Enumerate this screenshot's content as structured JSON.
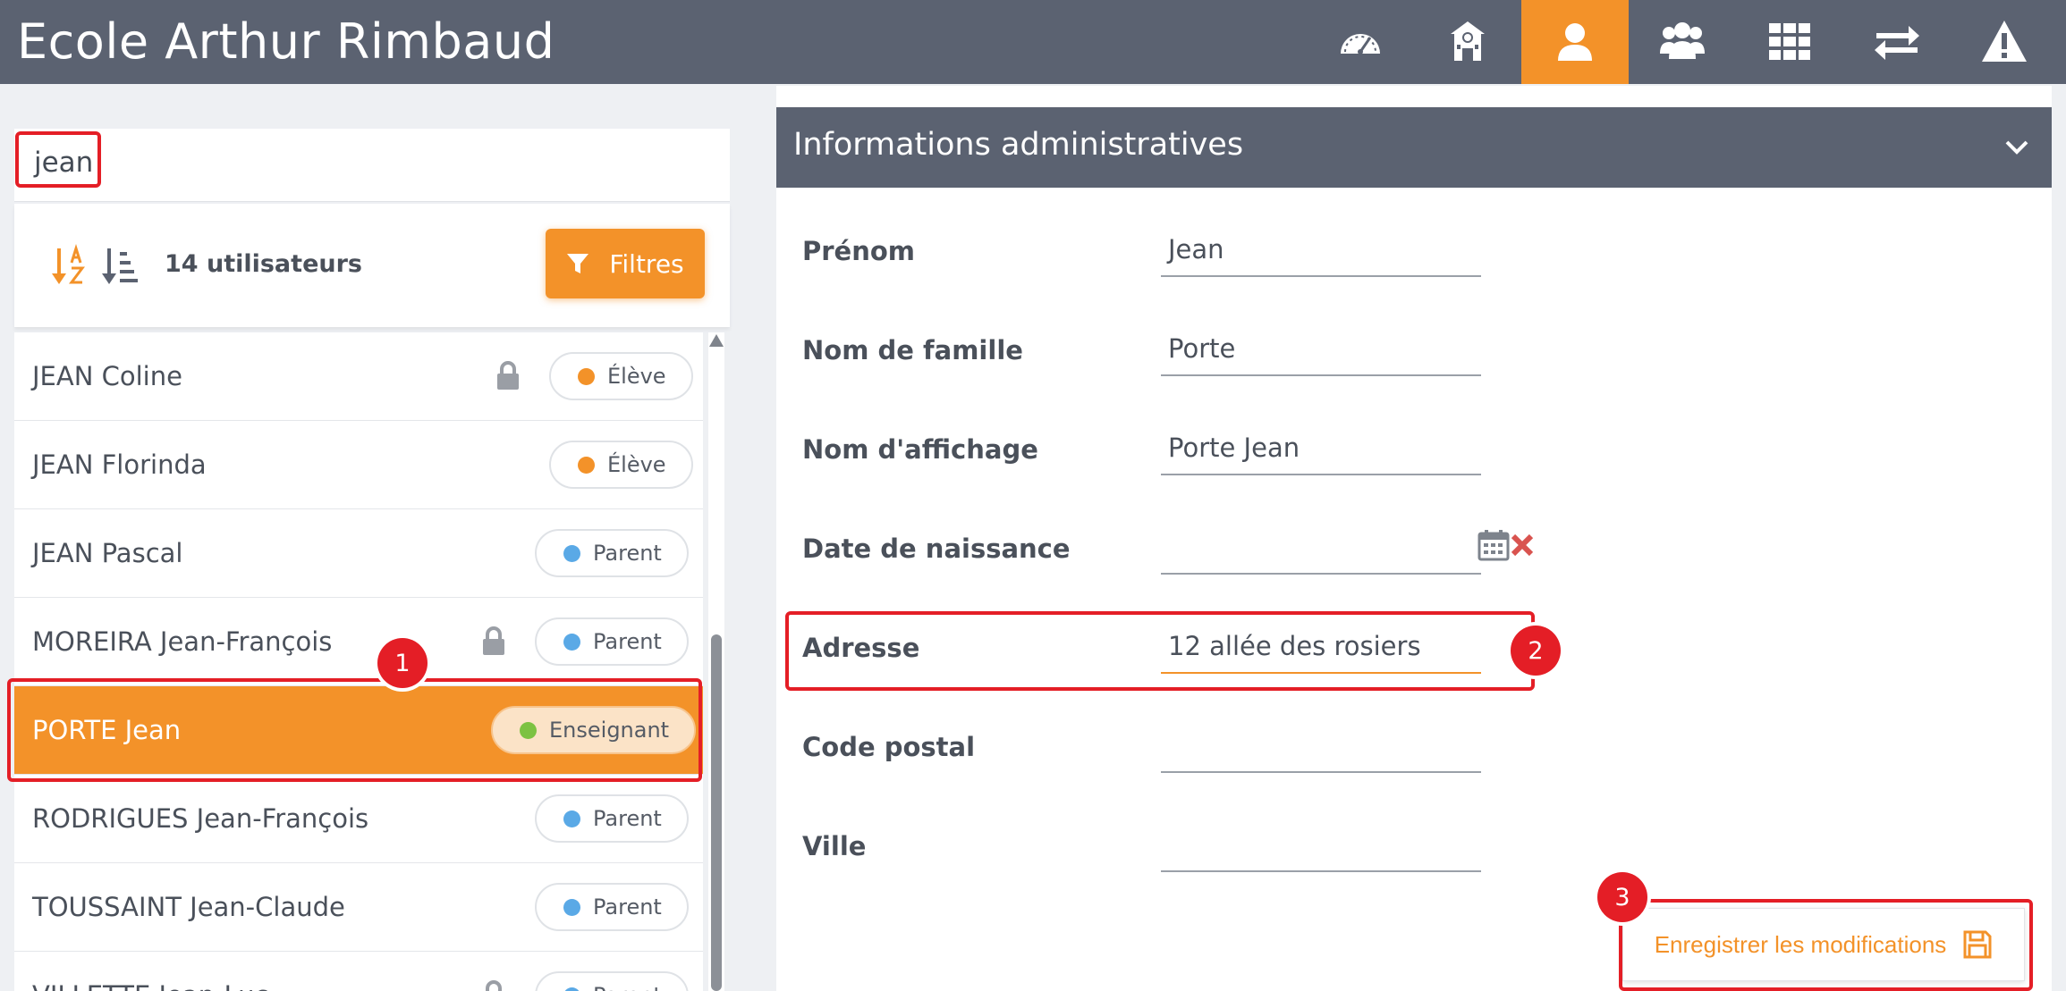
{
  "app": {
    "title": "Ecole Arthur Rimbaud"
  },
  "nav": {
    "items": [
      {
        "icon": "dashboard-gauge-icon"
      },
      {
        "icon": "school-building-icon"
      },
      {
        "icon": "user-icon",
        "active": true
      },
      {
        "icon": "users-group-icon"
      },
      {
        "icon": "apps-grid-icon"
      },
      {
        "icon": "transfer-arrows-icon"
      },
      {
        "icon": "warning-triangle-icon"
      }
    ]
  },
  "search": {
    "value": "jean"
  },
  "toolbar": {
    "count_label": "14 utilisateurs",
    "filter_label": "Filtres"
  },
  "users": [
    {
      "name": "JEAN Coline",
      "role": "Élève",
      "role_color": "#f39229",
      "locked": true,
      "selected": false
    },
    {
      "name": "JEAN Florinda",
      "role": "Élève",
      "role_color": "#f39229",
      "locked": false,
      "selected": false
    },
    {
      "name": "JEAN Pascal",
      "role": "Parent",
      "role_color": "#5aa9e6",
      "locked": false,
      "selected": false
    },
    {
      "name": "MOREIRA Jean-François",
      "role": "Parent",
      "role_color": "#5aa9e6",
      "locked": true,
      "selected": false
    },
    {
      "name": "PORTE Jean",
      "role": "Enseignant",
      "role_color": "#7cc242",
      "locked": false,
      "selected": true
    },
    {
      "name": "RODRIGUES Jean-François",
      "role": "Parent",
      "role_color": "#5aa9e6",
      "locked": false,
      "selected": false
    },
    {
      "name": "TOUSSAINT Jean-Claude",
      "role": "Parent",
      "role_color": "#5aa9e6",
      "locked": false,
      "selected": false
    },
    {
      "name": "VILLETTE Jean-Luc",
      "role": "Parent",
      "role_color": "#5aa9e6",
      "locked": true,
      "selected": false
    }
  ],
  "section": {
    "title": "Informations administratives"
  },
  "form": {
    "prenom": {
      "label": "Prénom",
      "value": "Jean"
    },
    "nom": {
      "label": "Nom de famille",
      "value": "Porte"
    },
    "affichage": {
      "label": "Nom d'affichage",
      "value": "Porte Jean"
    },
    "naissance": {
      "label": "Date de naissance",
      "value": ""
    },
    "adresse": {
      "label": "Adresse",
      "value": "12 allée des rosiers"
    },
    "code_postal": {
      "label": "Code postal",
      "value": ""
    },
    "ville": {
      "label": "Ville",
      "value": ""
    }
  },
  "actions": {
    "save_label": "Enregistrer les modifications"
  },
  "markers": {
    "m1": "1",
    "m2": "2",
    "m3": "3"
  },
  "colors": {
    "accent": "#f39229",
    "header": "#5b6271",
    "annotation": "#e41e26"
  }
}
